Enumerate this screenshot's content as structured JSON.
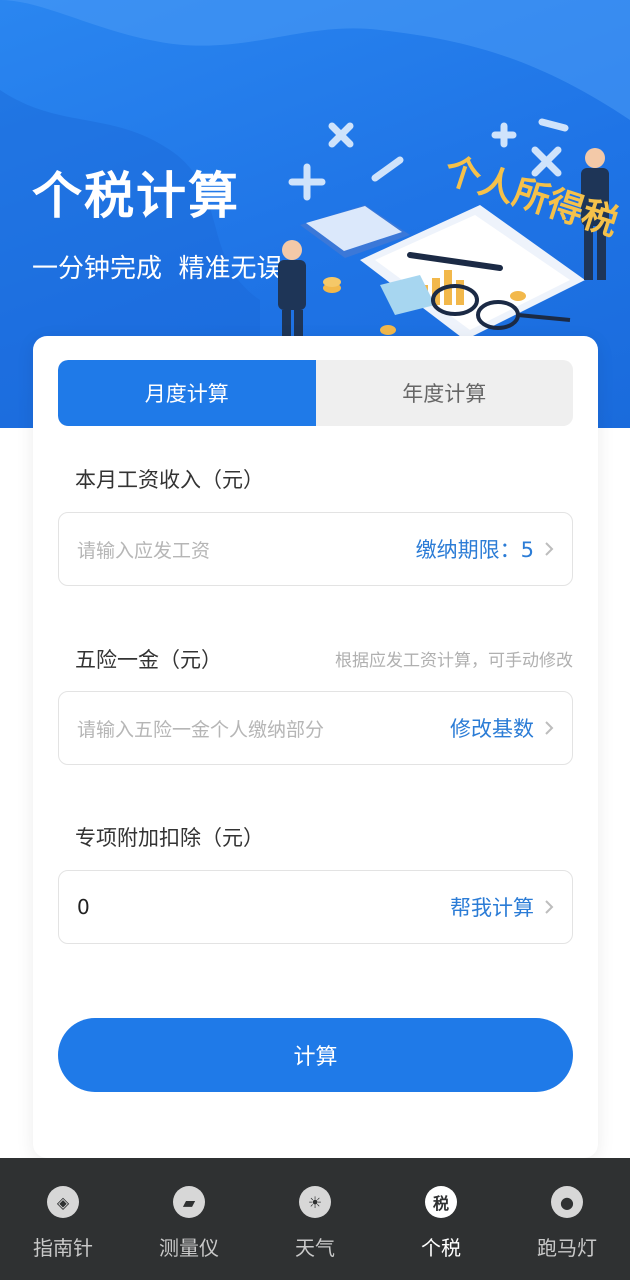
{
  "hero": {
    "title": "个税计算",
    "subtitle": "一分钟完成  精准无误",
    "illustration_text": "个人所得税"
  },
  "tabs": [
    {
      "label": "月度计算",
      "active": true
    },
    {
      "label": "年度计算",
      "active": false
    }
  ],
  "salary": {
    "label": "本月工资收入（元）",
    "placeholder": "请输入应发工资",
    "action_label": "缴纳期限：5"
  },
  "insurance": {
    "label": "五险一金（元）",
    "hint": "根据应发工资计算，可手动修改",
    "placeholder": "请输入五险一金个人缴纳部分",
    "action_label": "修改基数"
  },
  "deduction": {
    "label": "专项附加扣除（元）",
    "value": "0",
    "action_label": "帮我计算"
  },
  "calculate_button": "计算",
  "colors": {
    "accent": "#1f7ae8",
    "link": "#2b7cd6",
    "tabbar_bg": "#2f3132"
  },
  "tabbar": {
    "items": [
      {
        "label": "指南针",
        "icon": "compass-icon",
        "glyph": "◈"
      },
      {
        "label": "测量仪",
        "icon": "ruler-icon",
        "glyph": "▰"
      },
      {
        "label": "天气",
        "icon": "sun-icon",
        "glyph": "☀"
      },
      {
        "label": "个税",
        "icon": "tax-icon",
        "glyph": "税",
        "active": true
      },
      {
        "label": "跑马灯",
        "icon": "bulb-icon",
        "glyph": "●"
      }
    ]
  }
}
